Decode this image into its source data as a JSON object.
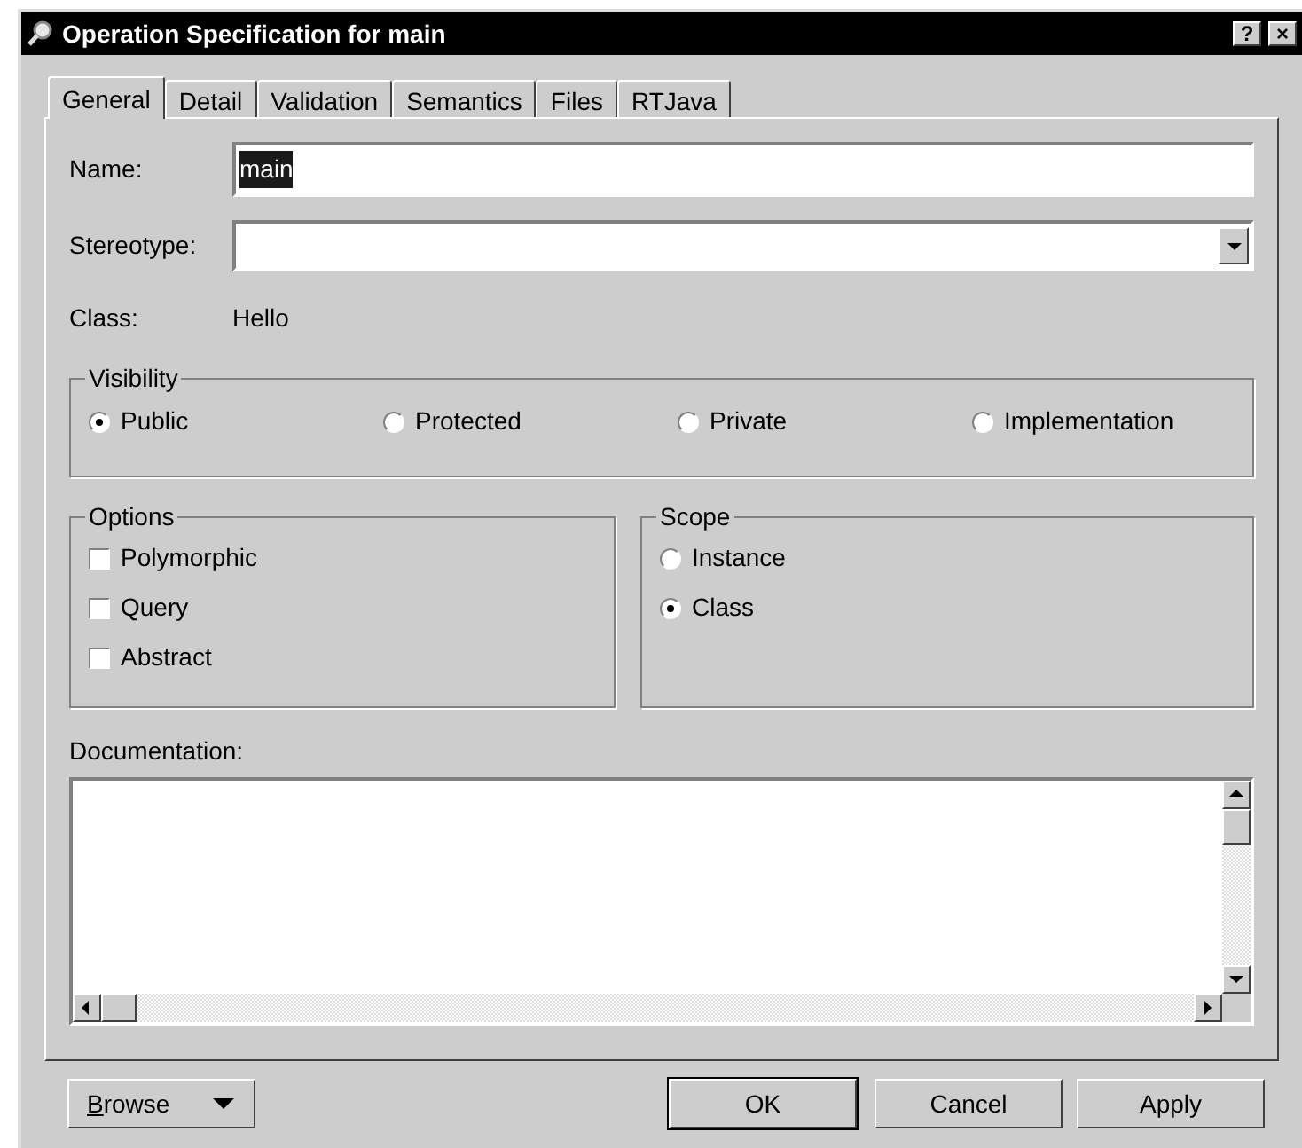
{
  "window": {
    "title": "Operation Specification for main",
    "title_buttons": [
      "?",
      "×"
    ]
  },
  "tabs": [
    {
      "label": "General",
      "selected": true
    },
    {
      "label": "Detail",
      "selected": false
    },
    {
      "label": "Validation",
      "selected": false
    },
    {
      "label": "Semantics",
      "selected": false
    },
    {
      "label": "Files",
      "selected": false
    },
    {
      "label": "RTJava",
      "selected": false
    }
  ],
  "name": {
    "label": "Name:",
    "value": "main",
    "value_selected": true
  },
  "stereotype": {
    "label": "Stereotype:"
  },
  "class": {
    "label": "Class:",
    "value": "Hello"
  },
  "visibility": {
    "title": "Visibility",
    "options": [
      {
        "label": "Public",
        "selected": true
      },
      {
        "label": "Protected",
        "selected": false
      },
      {
        "label": "Private",
        "selected": false
      },
      {
        "label": "Implementation",
        "selected": false
      }
    ]
  },
  "options": {
    "title": "Options",
    "items": [
      {
        "label": "Polymorphic",
        "checked": false
      },
      {
        "label": "Query",
        "checked": false
      },
      {
        "label": "Abstract",
        "checked": false
      }
    ]
  },
  "scope": {
    "title": "Scope",
    "options": [
      {
        "label": "Instance",
        "selected": false
      },
      {
        "label": "Class",
        "selected": true
      }
    ]
  },
  "documentation": {
    "label": "Documentation:"
  },
  "buttons": [
    {
      "label": "Browse",
      "kind": "menu"
    },
    {
      "label": "OK",
      "kind": "default"
    },
    {
      "label": "Cancel",
      "kind": "plain"
    },
    {
      "label": "Apply",
      "kind": "plain"
    }
  ]
}
